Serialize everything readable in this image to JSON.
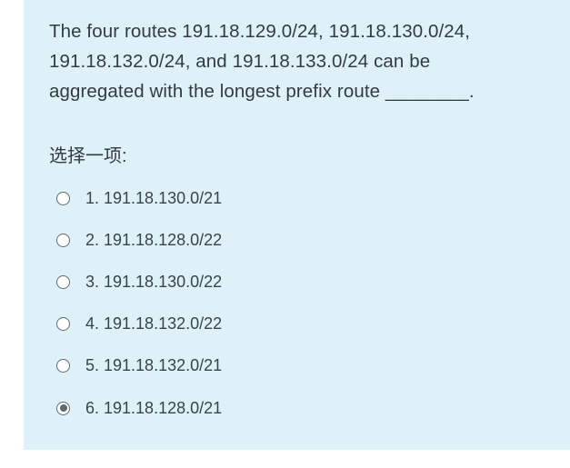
{
  "question": {
    "text": "The four routes 191.18.129.0/24, 191.18.130.0/24, 191.18.132.0/24, and 191.18.133.0/24 can be aggregated with the longest prefix route ________.",
    "prompt": "选择一项:"
  },
  "options": [
    {
      "label": "1. 191.18.130.0/21",
      "selected": false
    },
    {
      "label": "2. 191.18.128.0/22",
      "selected": false
    },
    {
      "label": "3. 191.18.130.0/22",
      "selected": false
    },
    {
      "label": "4. 191.18.132.0/22",
      "selected": false
    },
    {
      "label": "5. 191.18.132.0/21",
      "selected": false
    },
    {
      "label": "6. 191.18.128.0/21",
      "selected": true
    }
  ]
}
